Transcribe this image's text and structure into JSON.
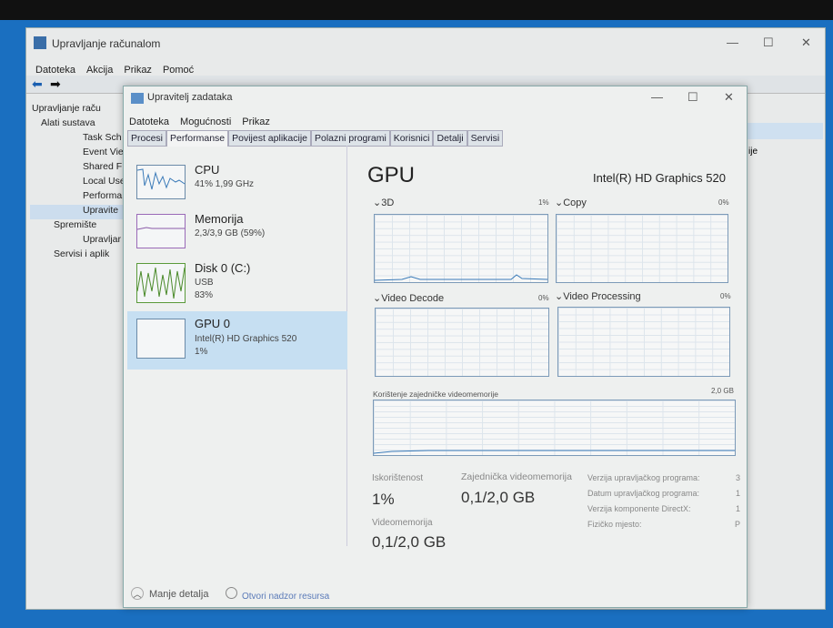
{
  "mmc": {
    "title": "Upravljanje računalom",
    "menu": [
      "Datoteka",
      "Akcija",
      "Prikaz",
      "Pomoć"
    ],
    "tree": [
      "Upravljanje raču",
      "Alati sustava",
      "Task Sch",
      "Event Vie",
      "Shared F",
      "Local Use",
      "Performa",
      "Upravite",
      "Spremište",
      "Upravljar",
      "Servisi i aplik"
    ],
    "right_item": "ije"
  },
  "tm": {
    "title": "Upravitelj zadataka",
    "menu": [
      "Datoteka",
      "Mogućnosti",
      "Prikaz"
    ],
    "tabs": [
      "Procesi",
      "Performanse",
      "Povijest aplikacije",
      "Polazni programi",
      "Korisnici",
      "Detalji",
      "Servisi"
    ],
    "side": [
      {
        "name": "CPU",
        "sub": "41% 1,99 GHz"
      },
      {
        "name": "Memorija",
        "sub": "2,3/3,9 GB (59%)"
      },
      {
        "name": "Disk 0 (C:)",
        "sub": "USB",
        "sub2": "83%"
      },
      {
        "name": "GPU 0",
        "sub": "Intel(R) HD Graphics 520",
        "sub2": "1%"
      }
    ],
    "heading": "GPU",
    "adapter": "Intel(R) HD Graphics 520",
    "graphs": [
      {
        "label": "3D",
        "pct": "1%"
      },
      {
        "label": "Copy",
        "pct": "0%"
      },
      {
        "label": "Video Decode",
        "pct": "0%"
      },
      {
        "label": "Video Processing",
        "pct": "0%"
      }
    ],
    "shared_label": "Korištenje zajedničke videomemorije",
    "shared_max": "2,0 GB",
    "stats": {
      "util_label": "Iskorištenost",
      "util": "1%",
      "shared_mem_label": "Zajednička videomemorija",
      "shared_mem": "0,1/2,0 GB",
      "vmem_label": "Videomemorija",
      "vmem": "0,1/2,0 GB"
    },
    "info": [
      {
        "k": "Verzija upravljačkog programa:",
        "v": "3"
      },
      {
        "k": "Datum upravljačkog programa:",
        "v": "1"
      },
      {
        "k": "Verzija komponente DirectX:",
        "v": "1"
      },
      {
        "k": "Fizičko mjesto:",
        "v": "P"
      }
    ],
    "footer": {
      "less": "Manje detalja",
      "monitor": "Otvori nadzor resursa"
    }
  }
}
